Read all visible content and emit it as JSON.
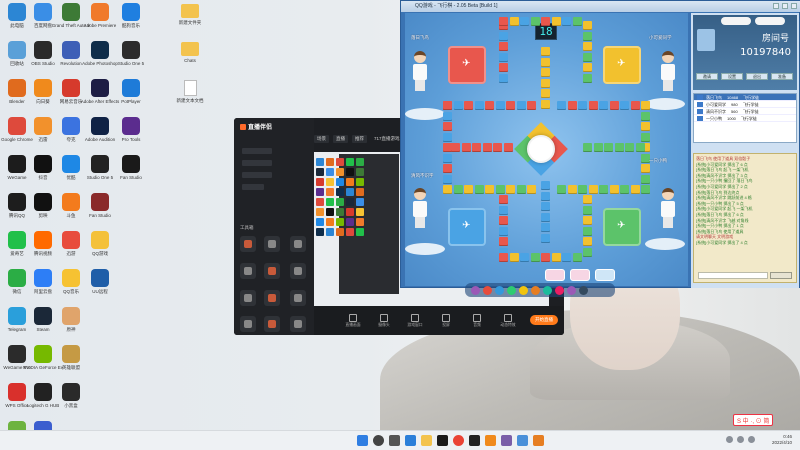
{
  "desktop": {
    "icons_col1": [
      {
        "label": "此电脑",
        "color": "#2c86d4"
      },
      {
        "label": "回收站",
        "color": "#5aa0d8"
      },
      {
        "label": "Blender",
        "color": "#e06b1e"
      },
      {
        "label": "Google Chrome",
        "color": "#de4a3c"
      },
      {
        "label": "WeGame",
        "color": "#1c1c1c"
      },
      {
        "label": "腾讯QQ",
        "color": "#1d1d1d"
      },
      {
        "label": "爱奇艺",
        "color": "#21c04a"
      },
      {
        "label": "微信",
        "color": "#2bad45"
      },
      {
        "label": "Telegram",
        "color": "#2a9fdb"
      },
      {
        "label": "WeGame Pro",
        "color": "#2b2b2b"
      },
      {
        "label": "WPS Office",
        "color": "#d9302c"
      },
      {
        "label": "记事本",
        "color": "#6db33f"
      }
    ],
    "icons_col2": [
      {
        "label": "百度网盘",
        "color": "#3a8ee6"
      },
      {
        "label": "OBS Studio",
        "color": "#2a2a2a"
      },
      {
        "label": "向日葵",
        "color": "#f08a1c"
      },
      {
        "label": "迅雷",
        "color": "#f2912c"
      },
      {
        "label": "抖音",
        "color": "#111111"
      },
      {
        "label": "剪映",
        "color": "#111111"
      },
      {
        "label": "腾讯视频",
        "color": "#ff6a00"
      },
      {
        "label": "阿里云盘",
        "color": "#2d7ef6"
      },
      {
        "label": "Steam",
        "color": "#1b2838"
      },
      {
        "label": "NVIDIA GeForce Experience",
        "color": "#76b900"
      },
      {
        "label": "Logitech G HUB",
        "color": "#222222"
      },
      {
        "label": "UU加速器",
        "color": "#3b5ecf"
      }
    ],
    "icons_col3": [
      {
        "label": "Grand Theft Auto V",
        "color": "#3d7a36"
      },
      {
        "label": "Revolution",
        "color": "#3d5fb7"
      },
      {
        "label": "网易云音乐",
        "color": "#d63a2c"
      },
      {
        "label": "夸克",
        "color": "#3b73e0"
      },
      {
        "label": "优酷",
        "color": "#1e88e5"
      },
      {
        "label": "斗鱼",
        "color": "#f37b1d"
      },
      {
        "label": "迅游",
        "color": "#e84c3d"
      },
      {
        "label": "QQ音乐",
        "color": "#f6c232"
      },
      {
        "label": "原神",
        "color": "#e0a46b"
      },
      {
        "label": "英雄联盟",
        "color": "#c59a44"
      },
      {
        "label": "小黑盒",
        "color": "#2a2a2a"
      }
    ],
    "icons_col4": [
      {
        "label": "Adobe Premiere",
        "color": "#f07a2b"
      },
      {
        "label": "Adobe Photoshop",
        "color": "#0f2d4a"
      },
      {
        "label": "Adobe After Effects",
        "color": "#1d1d44"
      },
      {
        "label": "Adobe Audition",
        "color": "#0f2245"
      },
      {
        "label": "Studio One 5",
        "color": "#222222"
      },
      {
        "label": "Fan Studio",
        "color": "#8a2a2a"
      },
      {
        "label": "QQ游戏",
        "color": "#f4c13a"
      },
      {
        "label": "UU远程",
        "color": "#1f5ea8"
      }
    ],
    "icons_col5": [
      {
        "label": "酷狗音乐",
        "color": "#1f7fe0"
      },
      {
        "label": "Studio One 5",
        "color": "#2c2c2c"
      },
      {
        "label": "PotPlayer",
        "color": "#1e7bd8"
      },
      {
        "label": "Pro Tools",
        "color": "#5b2c8e"
      },
      {
        "label": "Fan Studio",
        "color": "#1a1a1a"
      }
    ],
    "folders": [
      {
        "label": "新建文件夹"
      },
      {
        "label": "Chats"
      },
      {
        "label": "新建文本文档"
      }
    ]
  },
  "stream_app": {
    "logo": "直播伴侣",
    "tabs": [
      "场景",
      "直播",
      "推荐"
    ],
    "tools_label": "工具箱",
    "scene_label": "717直播游戏 01",
    "bottom_buttons": [
      "直播画面",
      "摄像头",
      "游戏窗口",
      "投屏",
      "音频",
      "动态特效"
    ],
    "go_live": "开始直播"
  },
  "game": {
    "window_title": "QQ游戏 - 飞行棋 - 2.05 Beta [Build 1]",
    "timer": "18",
    "players": [
      {
        "name": "落日飞鸟"
      },
      {
        "name": "小可爱同学"
      },
      {
        "name": "清风不识字"
      },
      {
        "name": "一只小鸭"
      }
    ],
    "room_label": "房间号",
    "room_id": "10197840",
    "side_buttons": [
      "邀请",
      "设置",
      "退出",
      "准备"
    ],
    "player_list": [
      {
        "name": "落日飞鸟",
        "score": "10468",
        "title": "飞行学徒"
      },
      {
        "name": "小可爱同学",
        "score": "980",
        "title": "飞行学徒"
      },
      {
        "name": "清风不识字",
        "score": "560",
        "title": "飞行学徒"
      },
      {
        "name": "一只小鸭",
        "score": "1000",
        "title": "飞行学徒"
      }
    ],
    "chat": [
      {
        "text": "落日飞鸟 使用了道具 双倍骰子",
        "red": true
      },
      {
        "text": "[系统]小可爱同学 掷出了 6 点",
        "red": false
      },
      {
        "text": "[系统]落日飞鸟 起飞 一架飞机",
        "red": false
      },
      {
        "text": "[系统]清风不识字 掷出了 3 点",
        "red": false
      },
      {
        "text": "[系统]一只小鸭 撞回了 落日飞鸟",
        "red": false
      },
      {
        "text": "[系统]小可爱同学 掷出了 2 点",
        "red": false
      },
      {
        "text": "[系统]落日飞鸟 到达终点",
        "red": false
      },
      {
        "text": "[系统]清风不识字 跳跃前进 4 格",
        "red": false
      },
      {
        "text": "[系统]一只小鸭 掷出了 5 点",
        "red": false
      },
      {
        "text": "[系统]小可爱同学 起飞 一架飞机",
        "red": false
      },
      {
        "text": "[系统]落日飞鸟 掷出了 6 点",
        "red": false
      },
      {
        "text": "[系统]清风不识字 飞越 对角线",
        "red": false
      },
      {
        "text": "[系统]一只小鸭 掷出了 1 点",
        "red": false
      },
      {
        "text": "[系统]落日飞鸟 使用了道具",
        "red": false
      },
      {
        "text": "请文明聊天 文明游戏",
        "red": true
      },
      {
        "text": "[系统]小可爱同学 掷出了 4 点",
        "red": false
      }
    ],
    "colors": {
      "red": "#e8574d",
      "yellow": "#f2c12e",
      "blue": "#4aa3e4",
      "green": "#5cc36a"
    }
  },
  "taskbar": {
    "time": "0:46",
    "date": "2022/4/10",
    "brand": "S 中 ·, ⊙ 简"
  }
}
